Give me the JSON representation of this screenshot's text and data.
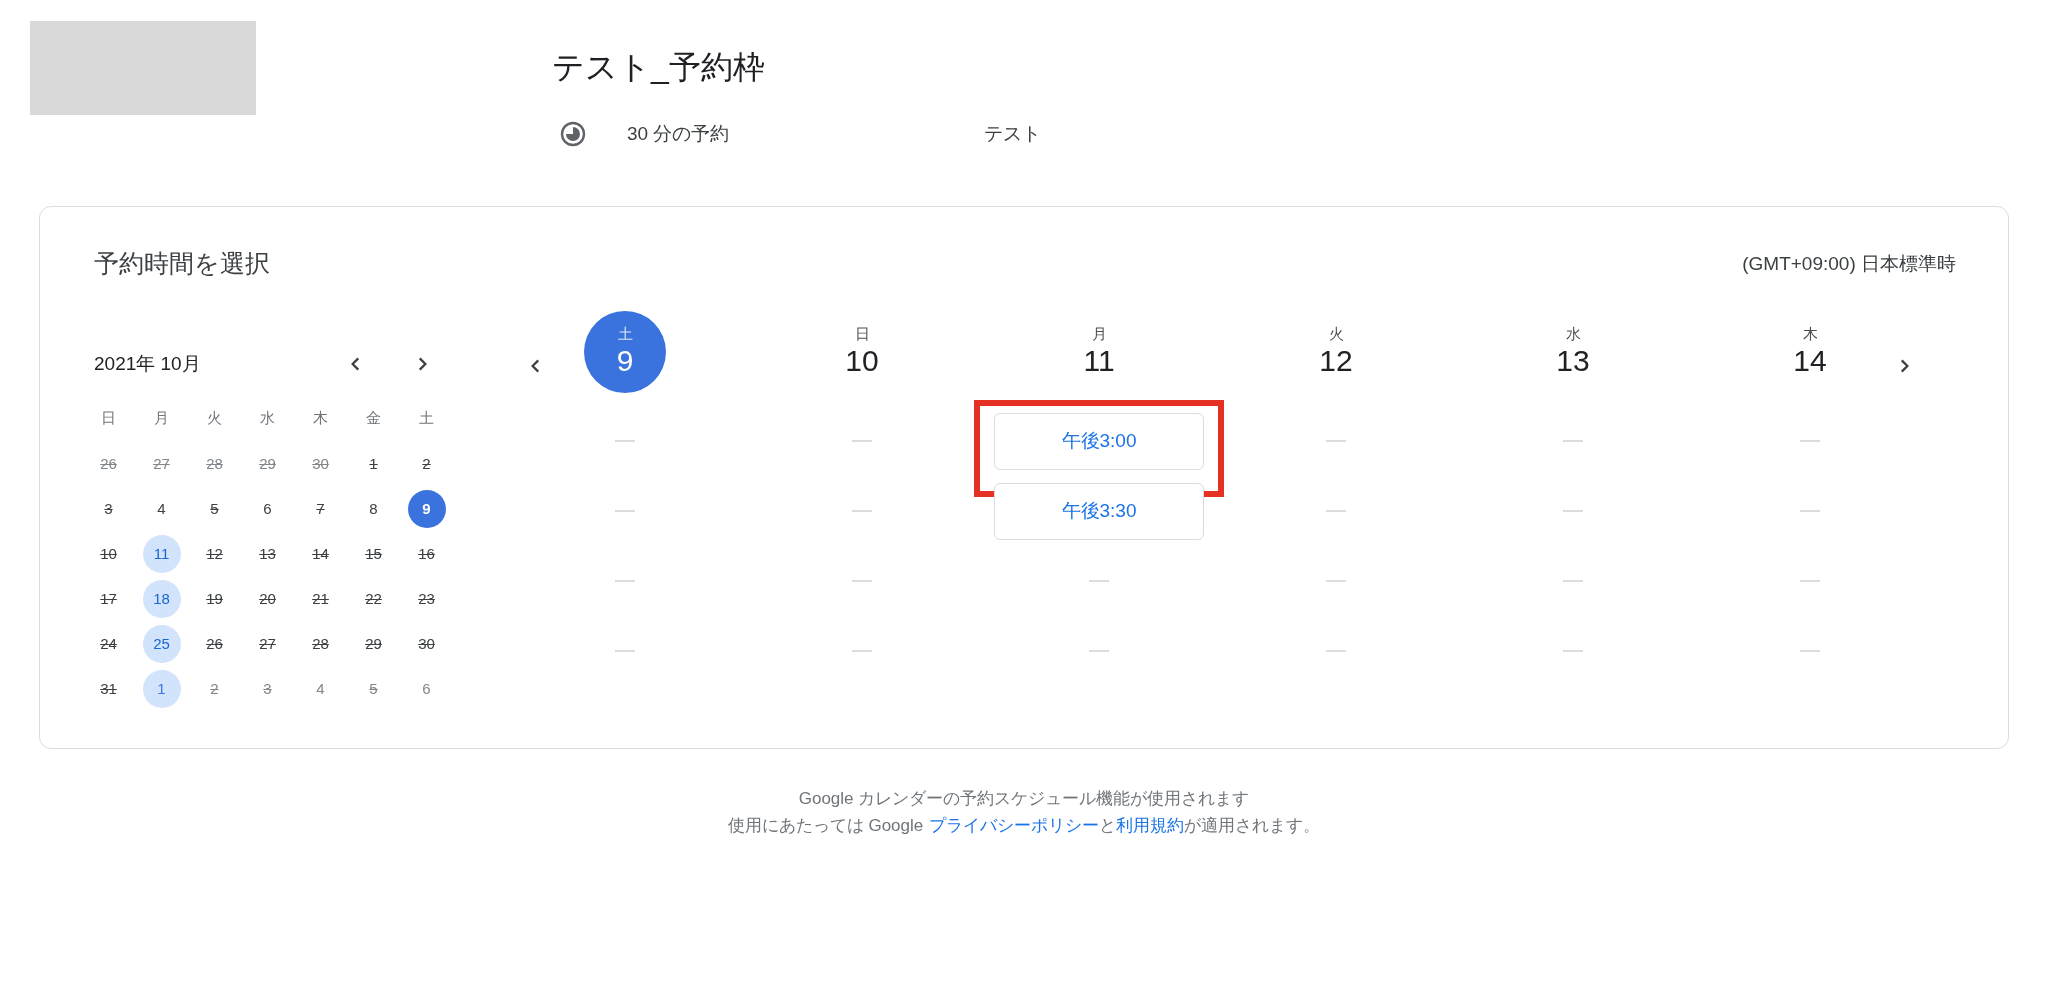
{
  "header": {
    "title": "テスト_予約枠",
    "duration": "30 分の予約",
    "description": "テスト"
  },
  "card": {
    "title": "予約時間を選択",
    "timezone": "(GMT+09:00) 日本標準時"
  },
  "mini_calendar": {
    "month": "2021年 10月",
    "weekdays": [
      "日",
      "月",
      "火",
      "水",
      "木",
      "金",
      "土"
    ],
    "weeks": [
      [
        {
          "label": "26",
          "kind": "disabled",
          "outside": true
        },
        {
          "label": "27",
          "kind": "disabled",
          "outside": true
        },
        {
          "label": "28",
          "kind": "disabled",
          "outside": true
        },
        {
          "label": "29",
          "kind": "disabled",
          "outside": true
        },
        {
          "label": "30",
          "kind": "disabled",
          "outside": true
        },
        {
          "label": "1",
          "kind": "disabled",
          "outside": false
        },
        {
          "label": "2",
          "kind": "disabled",
          "outside": false
        }
      ],
      [
        {
          "label": "3",
          "kind": "disabled",
          "outside": false
        },
        {
          "label": "4",
          "kind": "plain",
          "outside": false
        },
        {
          "label": "5",
          "kind": "disabled",
          "outside": false
        },
        {
          "label": "6",
          "kind": "plain",
          "outside": false
        },
        {
          "label": "7",
          "kind": "disabled",
          "outside": false
        },
        {
          "label": "8",
          "kind": "plain",
          "outside": false
        },
        {
          "label": "9",
          "kind": "selected",
          "outside": false
        }
      ],
      [
        {
          "label": "10",
          "kind": "disabled",
          "outside": false
        },
        {
          "label": "11",
          "kind": "available",
          "outside": false
        },
        {
          "label": "12",
          "kind": "disabled",
          "outside": false
        },
        {
          "label": "13",
          "kind": "disabled",
          "outside": false
        },
        {
          "label": "14",
          "kind": "disabled",
          "outside": false
        },
        {
          "label": "15",
          "kind": "disabled",
          "outside": false
        },
        {
          "label": "16",
          "kind": "disabled",
          "outside": false
        }
      ],
      [
        {
          "label": "17",
          "kind": "disabled",
          "outside": false
        },
        {
          "label": "18",
          "kind": "available",
          "outside": false
        },
        {
          "label": "19",
          "kind": "disabled",
          "outside": false
        },
        {
          "label": "20",
          "kind": "disabled",
          "outside": false
        },
        {
          "label": "21",
          "kind": "disabled",
          "outside": false
        },
        {
          "label": "22",
          "kind": "disabled",
          "outside": false
        },
        {
          "label": "23",
          "kind": "disabled",
          "outside": false
        }
      ],
      [
        {
          "label": "24",
          "kind": "disabled",
          "outside": false
        },
        {
          "label": "25",
          "kind": "available",
          "outside": false
        },
        {
          "label": "26",
          "kind": "disabled",
          "outside": false
        },
        {
          "label": "27",
          "kind": "disabled",
          "outside": false
        },
        {
          "label": "28",
          "kind": "disabled",
          "outside": false
        },
        {
          "label": "29",
          "kind": "disabled",
          "outside": false
        },
        {
          "label": "30",
          "kind": "disabled",
          "outside": false
        }
      ],
      [
        {
          "label": "31",
          "kind": "disabled",
          "outside": false
        },
        {
          "label": "1",
          "kind": "available",
          "outside": true
        },
        {
          "label": "2",
          "kind": "disabled",
          "outside": true
        },
        {
          "label": "3",
          "kind": "disabled",
          "outside": true
        },
        {
          "label": "4",
          "kind": "plain",
          "outside": true
        },
        {
          "label": "5",
          "kind": "disabled",
          "outside": true
        },
        {
          "label": "6",
          "kind": "plain",
          "outside": true
        }
      ]
    ]
  },
  "week": {
    "days": [
      {
        "weekday": "土",
        "date": "9",
        "selected": true,
        "slots": [
          {
            "kind": "empty"
          },
          {
            "kind": "empty"
          },
          {
            "kind": "empty"
          },
          {
            "kind": "empty"
          }
        ]
      },
      {
        "weekday": "日",
        "date": "10",
        "selected": false,
        "slots": [
          {
            "kind": "empty"
          },
          {
            "kind": "empty"
          },
          {
            "kind": "empty"
          },
          {
            "kind": "empty"
          }
        ]
      },
      {
        "weekday": "月",
        "date": "11",
        "selected": false,
        "slots": [
          {
            "kind": "time",
            "label": "午後3:00",
            "highlighted": true
          },
          {
            "kind": "time",
            "label": "午後3:30",
            "highlighted": false
          },
          {
            "kind": "empty"
          },
          {
            "kind": "empty"
          }
        ]
      },
      {
        "weekday": "火",
        "date": "12",
        "selected": false,
        "slots": [
          {
            "kind": "empty"
          },
          {
            "kind": "empty"
          },
          {
            "kind": "empty"
          },
          {
            "kind": "empty"
          }
        ]
      },
      {
        "weekday": "水",
        "date": "13",
        "selected": false,
        "slots": [
          {
            "kind": "empty"
          },
          {
            "kind": "empty"
          },
          {
            "kind": "empty"
          },
          {
            "kind": "empty"
          }
        ]
      },
      {
        "weekday": "木",
        "date": "14",
        "selected": false,
        "slots": [
          {
            "kind": "empty"
          },
          {
            "kind": "empty"
          },
          {
            "kind": "empty"
          },
          {
            "kind": "empty"
          }
        ]
      }
    ]
  },
  "footer": {
    "line_1": "Google カレンダーの予約スケジュール機能が使用されます",
    "line_2_before": "使用にあたっては Google",
    "privacy_link": "プライバシーポリシー",
    "connector": "と",
    "terms_link": "利用規約",
    "line_2_after": "が適用されます。"
  }
}
